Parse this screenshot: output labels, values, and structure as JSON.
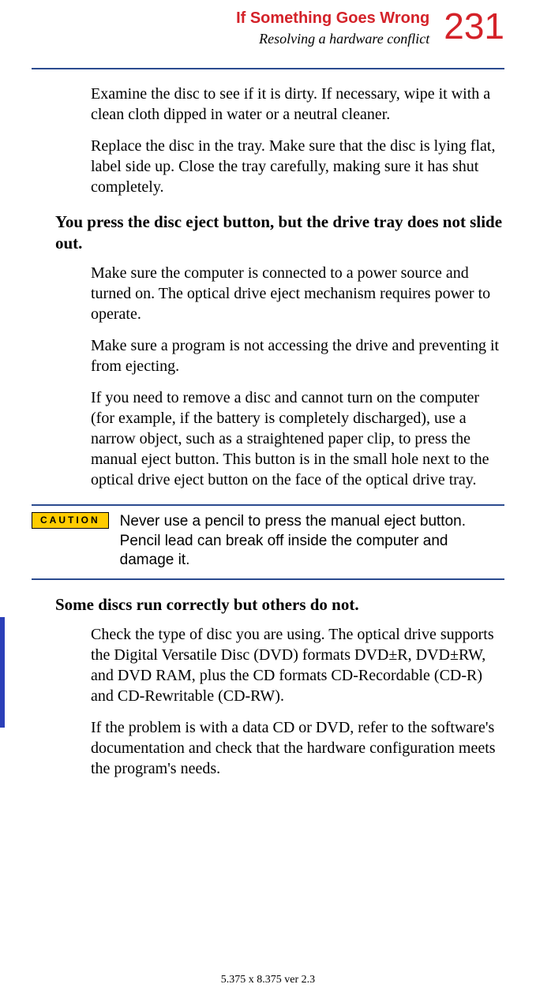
{
  "header": {
    "chapter": "If Something Goes Wrong",
    "section": "Resolving a hardware conflict",
    "page_number": "231"
  },
  "paragraphs": {
    "p1": "Examine the disc to see if it is dirty. If necessary, wipe it with a clean cloth dipped in water or a neutral cleaner.",
    "p2": "Replace the disc in the tray. Make sure that the disc is lying flat, label side up. Close the tray carefully, making sure it has shut completely.",
    "h1": "You press the disc eject button, but the drive tray does not slide out.",
    "p3": "Make sure the computer is connected to a power source and turned on. The optical drive eject mechanism requires power to operate.",
    "p4": "Make sure a program is not accessing the drive and preventing it from ejecting.",
    "p5": "If you need to remove a disc and cannot turn on the computer (for example, if the battery is completely discharged), use a narrow object, such as a straightened paper clip, to press the manual eject button. This button is in the small hole next to the optical drive eject button on the face of the optical drive tray.",
    "caution_label": "CAUTION",
    "caution_text": "Never use a pencil to press the manual eject button. Pencil lead can break off inside the computer and damage it.",
    "h2": "Some discs run correctly but others do not.",
    "p6": "Check the type of disc you are using. The optical drive supports the Digital Versatile Disc (DVD) formats DVD±R, DVD±RW, and DVD RAM, plus the CD formats CD-Recordable (CD-R) and CD-Rewritable (CD-RW).",
    "p7": "If the problem is with a data CD or DVD, refer to the software's documentation and check that the hardware configuration meets the program's needs."
  },
  "footer": "5.375 x 8.375 ver 2.3"
}
